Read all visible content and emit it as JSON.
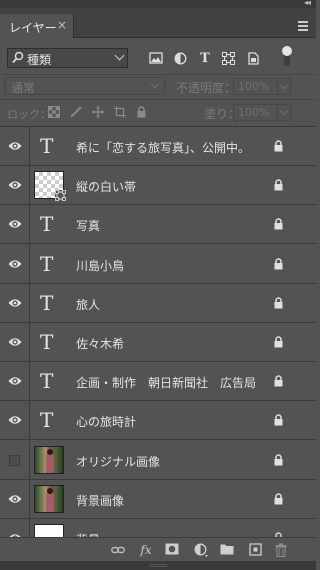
{
  "panel": {
    "tab_label": "レイヤー",
    "tab_close": "×",
    "collapse_glyph": "◂◂",
    "close_glyph": "×"
  },
  "filter": {
    "kind_value": "種類",
    "icons": [
      "image-filter-icon",
      "adjustment-filter-icon",
      "type-filter-icon",
      "shape-filter-icon",
      "smart-object-filter-icon"
    ],
    "toggle_on": true
  },
  "blend": {
    "mode": "通常",
    "opacity_label": "不透明度：",
    "opacity_value": "100%"
  },
  "lock": {
    "label": "ロック：",
    "icons": [
      "lock-transparent-pixels-icon",
      "lock-image-pixels-icon",
      "lock-position-icon",
      "lock-artboard-icon",
      "lock-all-icon"
    ],
    "fill_label": "塗り：",
    "fill_value": "100%"
  },
  "layers": [
    {
      "name": "希に「恋する旅写真」、公開中。",
      "type": "text",
      "visible": true,
      "locked": true
    },
    {
      "name": "縦の白い帯",
      "type": "shape",
      "visible": true,
      "locked": true
    },
    {
      "name": "写真",
      "type": "text",
      "visible": true,
      "locked": true
    },
    {
      "name": "川島小鳥",
      "type": "text",
      "visible": true,
      "locked": true
    },
    {
      "name": "旅人",
      "type": "text",
      "visible": true,
      "locked": true
    },
    {
      "name": "佐々木希",
      "type": "text",
      "visible": true,
      "locked": true
    },
    {
      "name": "企画・制作　朝日新聞社　広告局",
      "type": "text",
      "visible": true,
      "locked": true
    },
    {
      "name": "心の旅時計",
      "type": "text",
      "visible": true,
      "locked": true
    },
    {
      "name": "オリジナル画像",
      "type": "image",
      "visible": false,
      "locked": true
    },
    {
      "name": "背景画像",
      "type": "image",
      "visible": true,
      "locked": true
    },
    {
      "name": "背景",
      "type": "background",
      "visible": true,
      "locked": true
    }
  ],
  "footer": {
    "buttons": [
      "link-layers-icon",
      "fx-icon",
      "add-mask-icon",
      "adjustment-layer-icon",
      "new-group-icon",
      "new-layer-icon",
      "delete-layer-icon"
    ],
    "fx_label": "fx"
  }
}
